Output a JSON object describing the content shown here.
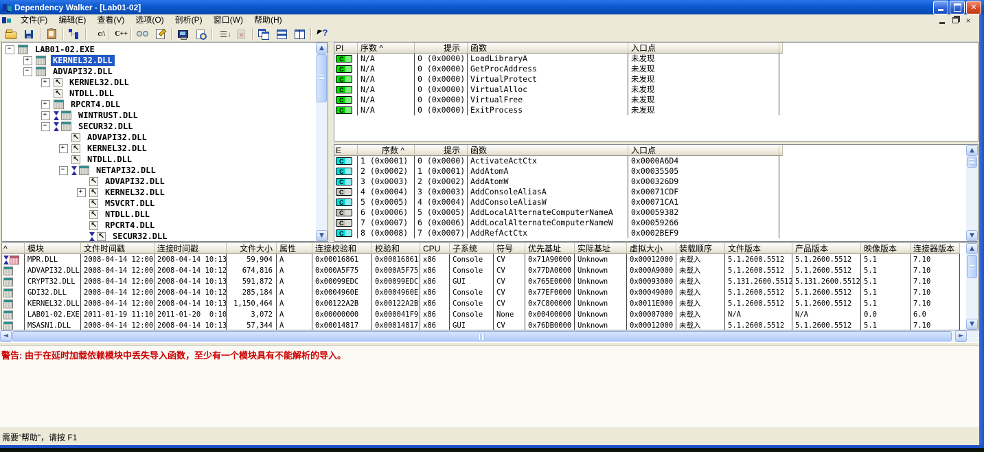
{
  "titlebar": {
    "title": "Dependency Walker - [Lab01-02]"
  },
  "menu": {
    "items": [
      "文件(F)",
      "编辑(E)",
      "查看(V)",
      "选项(O)",
      "剖析(P)",
      "窗口(W)",
      "帮助(H)"
    ]
  },
  "toolbar": {
    "buttons": [
      {
        "type": "btn",
        "name": "open-file-button",
        "icon": "open",
        "label": "",
        "interactable": "true"
      },
      {
        "type": "btn",
        "name": "save-button",
        "icon": "save",
        "label": "",
        "interactable": "true"
      },
      {
        "type": "sep",
        "name": "toolbar-separator",
        "icon": "none",
        "label": "",
        "interactable": "false"
      },
      {
        "type": "btn",
        "name": "copy-button",
        "icon": "paste",
        "label": "",
        "interactable": "true"
      },
      {
        "type": "sep",
        "name": "toolbar-separator",
        "icon": "none",
        "label": "",
        "interactable": "false"
      },
      {
        "type": "btn",
        "name": "auto-expand-button",
        "icon": "tree",
        "label": "",
        "interactable": "true"
      },
      {
        "type": "sep",
        "name": "toolbar-separator",
        "icon": "none",
        "label": "",
        "interactable": "false"
      },
      {
        "type": "btn",
        "name": "full-paths-button",
        "icon": "cpath",
        "label": "c:\\",
        "interactable": "true"
      },
      {
        "type": "sep",
        "name": "toolbar-separator",
        "icon": "none",
        "label": "",
        "interactable": "false"
      },
      {
        "type": "btn",
        "name": "undecorate-cpp-button",
        "icon": "cpp",
        "label": "C++",
        "interactable": "true"
      },
      {
        "type": "sep",
        "name": "toolbar-separator",
        "icon": "none",
        "label": "",
        "interactable": "false"
      },
      {
        "type": "btn",
        "name": "view-module-button",
        "icon": "glasses",
        "label": "",
        "interactable": "true"
      },
      {
        "type": "btn",
        "name": "properties-button",
        "icon": "props",
        "label": "",
        "interactable": "true"
      },
      {
        "type": "sep",
        "name": "toolbar-separator",
        "icon": "none",
        "label": "",
        "interactable": "false"
      },
      {
        "type": "btn",
        "name": "system-info-button",
        "icon": "computer",
        "label": "",
        "interactable": "true"
      },
      {
        "type": "btn",
        "name": "search-button",
        "icon": "search",
        "label": "",
        "interactable": "true"
      },
      {
        "type": "sep",
        "name": "toolbar-separator",
        "icon": "none",
        "label": "",
        "interactable": "false"
      },
      {
        "type": "btn",
        "name": "sort-button",
        "icon": "sort",
        "label": "",
        "interactable": "true"
      },
      {
        "type": "btn",
        "name": "refresh-disabled-button",
        "icon": "nodoc",
        "label": "",
        "interactable": "false"
      },
      {
        "type": "sep",
        "name": "toolbar-separator",
        "icon": "none",
        "label": "",
        "interactable": "false"
      },
      {
        "type": "btn",
        "name": "cascade-windows-button",
        "icon": "cascade",
        "label": "",
        "interactable": "true"
      },
      {
        "type": "btn",
        "name": "tile-horizontal-button",
        "icon": "tileh",
        "label": "",
        "interactable": "true"
      },
      {
        "type": "btn",
        "name": "tile-vertical-button",
        "icon": "tilev",
        "label": "",
        "interactable": "true"
      },
      {
        "type": "sep",
        "name": "toolbar-separator",
        "icon": "none",
        "label": "",
        "interactable": "false"
      },
      {
        "type": "btn",
        "name": "context-help-button",
        "icon": "help",
        "label": "",
        "interactable": "true"
      }
    ]
  },
  "tree": {
    "items": [
      {
        "label": "LAB01-02.EXE",
        "level": 0,
        "exp": "minus",
        "icon": "module",
        "delay": "n",
        "sel": "n"
      },
      {
        "label": "KERNEL32.DLL",
        "level": 1,
        "exp": "plus",
        "icon": "module",
        "delay": "n",
        "sel": "y"
      },
      {
        "label": "ADVAPI32.DLL",
        "level": 1,
        "exp": "minus",
        "icon": "module",
        "delay": "n",
        "sel": "n"
      },
      {
        "label": "KERNEL32.DLL",
        "level": 2,
        "exp": "plus",
        "icon": "forward",
        "delay": "n",
        "sel": "n"
      },
      {
        "label": "NTDLL.DLL",
        "level": 2,
        "exp": "none",
        "icon": "forward",
        "delay": "n",
        "sel": "n"
      },
      {
        "label": "RPCRT4.DLL",
        "level": 2,
        "exp": "plus",
        "icon": "module",
        "delay": "n",
        "sel": "n"
      },
      {
        "label": "WINTRUST.DLL",
        "level": 2,
        "exp": "plus",
        "icon": "module",
        "delay": "y",
        "sel": "n"
      },
      {
        "label": "SECUR32.DLL",
        "level": 2,
        "exp": "minus",
        "icon": "module",
        "delay": "y",
        "sel": "n"
      },
      {
        "label": "ADVAPI32.DLL",
        "level": 3,
        "exp": "none",
        "icon": "forward",
        "delay": "n",
        "sel": "n"
      },
      {
        "label": "KERNEL32.DLL",
        "level": 3,
        "exp": "plus",
        "icon": "forward",
        "delay": "n",
        "sel": "n"
      },
      {
        "label": "NTDLL.DLL",
        "level": 3,
        "exp": "none",
        "icon": "forward",
        "delay": "n",
        "sel": "n"
      },
      {
        "label": "NETAPI32.DLL",
        "level": 3,
        "exp": "minus",
        "icon": "module",
        "delay": "y",
        "sel": "n"
      },
      {
        "label": "ADVAPI32.DLL",
        "level": 4,
        "exp": "none",
        "icon": "forward",
        "delay": "n",
        "sel": "n"
      },
      {
        "label": "KERNEL32.DLL",
        "level": 4,
        "exp": "plus",
        "icon": "forward",
        "delay": "n",
        "sel": "n"
      },
      {
        "label": "MSVCRT.DLL",
        "level": 4,
        "exp": "none",
        "icon": "forward",
        "delay": "n",
        "sel": "n"
      },
      {
        "label": "NTDLL.DLL",
        "level": 4,
        "exp": "none",
        "icon": "forward",
        "delay": "n",
        "sel": "n"
      },
      {
        "label": "RPCRT4.DLL",
        "level": 4,
        "exp": "none",
        "icon": "forward",
        "delay": "n",
        "sel": "n"
      },
      {
        "label": "SECUR32.DLL",
        "level": 4,
        "exp": "none",
        "icon": "forward",
        "delay": "y",
        "sel": "n"
      }
    ]
  },
  "imports": {
    "headers": [
      "PI",
      "序数 ^",
      "提示",
      "函数",
      "入口点",
      ""
    ],
    "rows": [
      {
        "icon": "green",
        "ordinal": "N/A",
        "hint": "0 (0x0000)",
        "function": "LoadLibraryA",
        "entry": "未发现"
      },
      {
        "icon": "green",
        "ordinal": "N/A",
        "hint": "0 (0x0000)",
        "function": "GetProcAddress",
        "entry": "未发现"
      },
      {
        "icon": "green",
        "ordinal": "N/A",
        "hint": "0 (0x0000)",
        "function": "VirtualProtect",
        "entry": "未发现"
      },
      {
        "icon": "green",
        "ordinal": "N/A",
        "hint": "0 (0x0000)",
        "function": "VirtualAlloc",
        "entry": "未发现"
      },
      {
        "icon": "green",
        "ordinal": "N/A",
        "hint": "0 (0x0000)",
        "function": "VirtualFree",
        "entry": "未发现"
      },
      {
        "icon": "green",
        "ordinal": "N/A",
        "hint": "0 (0x0000)",
        "function": "ExitProcess",
        "entry": "未发现"
      }
    ]
  },
  "exports": {
    "headers": [
      "E",
      "序数 ^",
      "提示",
      "函数",
      "入口点",
      ""
    ],
    "rows": [
      {
        "icon": "cyan",
        "ordinal": "1 (0x0001)",
        "hint": "0 (0x0000)",
        "function": "ActivateActCtx",
        "entry": "0x0000A6D4"
      },
      {
        "icon": "cyan",
        "ordinal": "2 (0x0002)",
        "hint": "1 (0x0001)",
        "function": "AddAtomA",
        "entry": "0x00035505"
      },
      {
        "icon": "cyan",
        "ordinal": "3 (0x0003)",
        "hint": "2 (0x0002)",
        "function": "AddAtomW",
        "entry": "0x000326D9"
      },
      {
        "icon": "gray",
        "ordinal": "4 (0x0004)",
        "hint": "3 (0x0003)",
        "function": "AddConsoleAliasA",
        "entry": "0x00071CDF"
      },
      {
        "icon": "cyan",
        "ordinal": "5 (0x0005)",
        "hint": "4 (0x0004)",
        "function": "AddConsoleAliasW",
        "entry": "0x00071CA1"
      },
      {
        "icon": "gray",
        "ordinal": "6 (0x0006)",
        "hint": "5 (0x0005)",
        "function": "AddLocalAlternateComputerNameA",
        "entry": "0x00059382"
      },
      {
        "icon": "gray",
        "ordinal": "7 (0x0007)",
        "hint": "6 (0x0006)",
        "function": "AddLocalAlternateComputerNameW",
        "entry": "0x00059266"
      },
      {
        "icon": "cyan",
        "ordinal": "8 (0x0008)",
        "hint": "7 (0x0007)",
        "function": "AddRefActCtx",
        "entry": "0x0002BEF9"
      }
    ]
  },
  "modules": {
    "headers": [
      "^",
      "模块",
      "文件时间戳",
      "连接时间戳",
      "文件大小",
      "属性",
      "连接校验和",
      "校验和",
      "CPU",
      "子系统",
      "符号",
      "优先基址",
      "实际基址",
      "虚拟大小",
      "装载顺序",
      "文件版本",
      "产品版本",
      "映像版本",
      "连接器版本"
    ],
    "rows": [
      {
        "delay": "y",
        "icon": "missing",
        "module": "MPR.DLL",
        "file_time": "2008-04-14 12:00",
        "link_time": "2008-04-14 10:13",
        "size": "59,904",
        "attr": "A",
        "link_checksum": "0x00016861",
        "checksum": "0x00016861",
        "cpu": "x86",
        "subsystem": "Console",
        "symbols": "CV",
        "pref_base": "0x71A90000",
        "actual_base": "Unknown",
        "virtual_size": "0x00012000",
        "load_order": "未载入",
        "file_ver": "5.1.2600.5512",
        "prod_ver": "5.1.2600.5512",
        "image_ver": "5.1",
        "linker_ver": "7.10"
      },
      {
        "delay": "n",
        "icon": "ok",
        "module": "ADVAPI32.DLL",
        "file_time": "2008-04-14 12:00",
        "link_time": "2008-04-14 10:12",
        "size": "674,816",
        "attr": "A",
        "link_checksum": "0x000A5F75",
        "checksum": "0x000A5F75",
        "cpu": "x86",
        "subsystem": "Console",
        "symbols": "CV",
        "pref_base": "0x77DA0000",
        "actual_base": "Unknown",
        "virtual_size": "0x000A9000",
        "load_order": "未载入",
        "file_ver": "5.1.2600.5512",
        "prod_ver": "5.1.2600.5512",
        "image_ver": "5.1",
        "linker_ver": "7.10"
      },
      {
        "delay": "n",
        "icon": "ok",
        "module": "CRYPT32.DLL",
        "file_time": "2008-04-14 12:00",
        "link_time": "2008-04-14 10:13",
        "size": "591,872",
        "attr": "A",
        "link_checksum": "0x00099EDC",
        "checksum": "0x00099EDC",
        "cpu": "x86",
        "subsystem": "GUI",
        "symbols": "CV",
        "pref_base": "0x765E0000",
        "actual_base": "Unknown",
        "virtual_size": "0x00093000",
        "load_order": "未载入",
        "file_ver": "5.131.2600.5512",
        "prod_ver": "5.131.2600.5512",
        "image_ver": "5.1",
        "linker_ver": "7.10"
      },
      {
        "delay": "n",
        "icon": "ok",
        "module": "GDI32.DLL",
        "file_time": "2008-04-14 12:00",
        "link_time": "2008-04-14 10:12",
        "size": "285,184",
        "attr": "A",
        "link_checksum": "0x0004960E",
        "checksum": "0x0004960E",
        "cpu": "x86",
        "subsystem": "Console",
        "symbols": "CV",
        "pref_base": "0x77EF0000",
        "actual_base": "Unknown",
        "virtual_size": "0x00049000",
        "load_order": "未载入",
        "file_ver": "5.1.2600.5512",
        "prod_ver": "5.1.2600.5512",
        "image_ver": "5.1",
        "linker_ver": "7.10"
      },
      {
        "delay": "n",
        "icon": "ok",
        "module": "KERNEL32.DLL",
        "file_time": "2008-04-14 12:00",
        "link_time": "2008-04-14 10:13",
        "size": "1,150,464",
        "attr": "A",
        "link_checksum": "0x00122A2B",
        "checksum": "0x00122A2B",
        "cpu": "x86",
        "subsystem": "Console",
        "symbols": "CV",
        "pref_base": "0x7C800000",
        "actual_base": "Unknown",
        "virtual_size": "0x0011E000",
        "load_order": "未载入",
        "file_ver": "5.1.2600.5512",
        "prod_ver": "5.1.2600.5512",
        "image_ver": "5.1",
        "linker_ver": "7.10"
      },
      {
        "delay": "n",
        "icon": "ok",
        "module": "LAB01-02.EXE",
        "file_time": "2011-01-19 11:10",
        "link_time": "2011-01-20  0:10",
        "size": "3,072",
        "attr": "A",
        "link_checksum": "0x00000000",
        "checksum": "0x000041F9",
        "cpu": "x86",
        "subsystem": "Console",
        "symbols": "None",
        "pref_base": "0x00400000",
        "actual_base": "Unknown",
        "virtual_size": "0x00007000",
        "load_order": "未载入",
        "file_ver": "N/A",
        "prod_ver": "N/A",
        "image_ver": "0.0",
        "linker_ver": "6.0"
      },
      {
        "delay": "n",
        "icon": "ok",
        "module": "MSASN1.DLL",
        "file_time": "2008-04-14 12:00",
        "link_time": "2008-04-14 10:13",
        "size": "57,344",
        "attr": "A",
        "link_checksum": "0x00014817",
        "checksum": "0x00014817",
        "cpu": "x86",
        "subsystem": "GUI",
        "symbols": "CV",
        "pref_base": "0x76DB0000",
        "actual_base": "Unknown",
        "virtual_size": "0x00012000",
        "load_order": "未载入",
        "file_ver": "5.1.2600.5512",
        "prod_ver": "5.1.2600.5512",
        "image_ver": "5.1",
        "linker_ver": "7.10"
      }
    ]
  },
  "log": {
    "warning": "警告: 由于在延时加载依赖模块中丢失导入函数，至少有一个模块具有不能解析的导入。"
  },
  "status": {
    "text": "需要“帮助”，请按 F1"
  },
  "colors": {
    "titlebar": "#0C59CE",
    "selection": "#2158C8",
    "warning_text": "#CC0000",
    "import_icon": "#00DC00",
    "export_called_icon": "#00E0E0",
    "export_uncalled_icon": "#C4C4BC"
  }
}
